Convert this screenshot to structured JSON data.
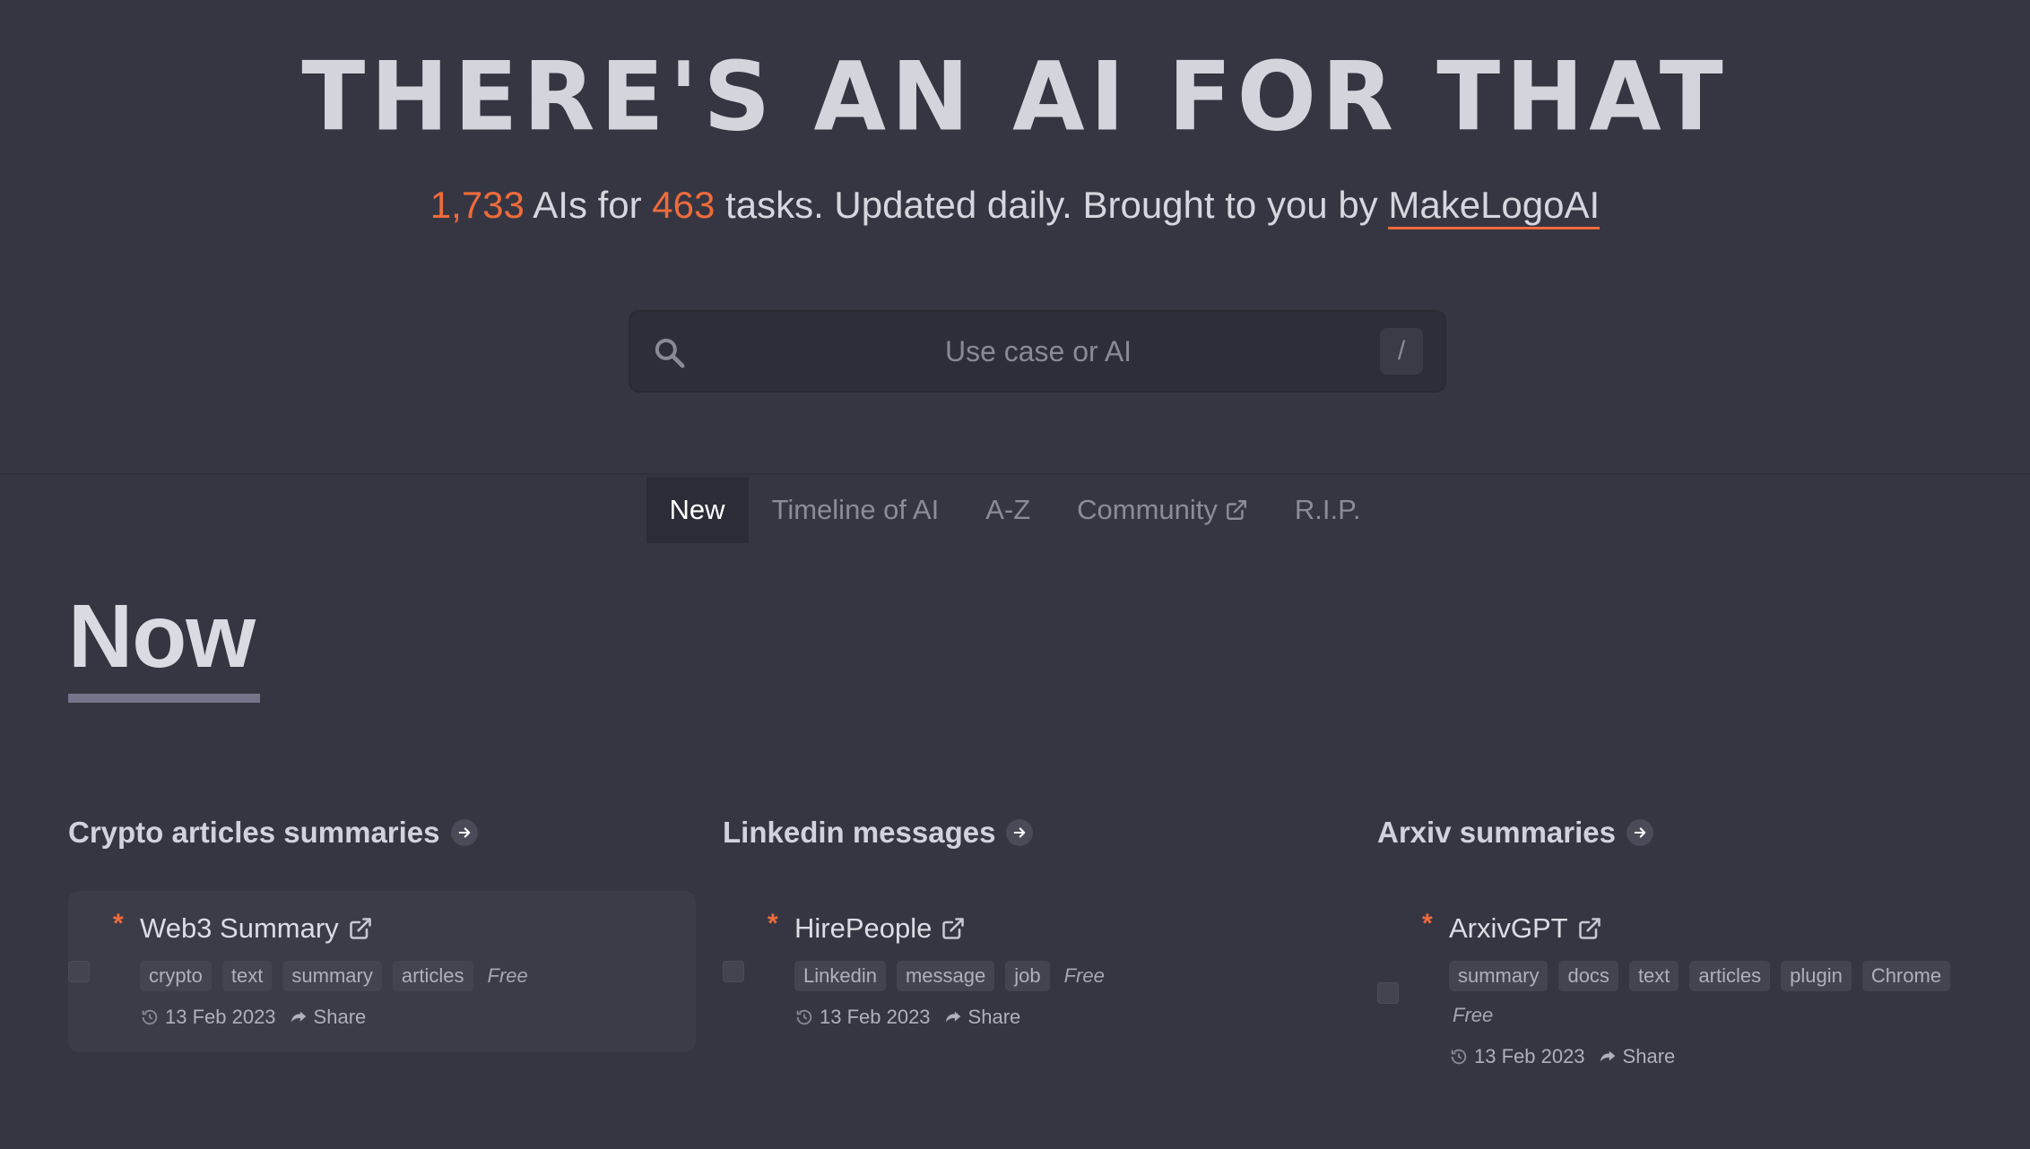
{
  "header": {
    "title": "THERE'S AN AI FOR THAT",
    "ai_count": "1,733",
    "ais_for": " AIs for ",
    "task_count": "463",
    "tasks_text": " tasks. Updated daily. Brought to you by ",
    "brand": "MakeLogoAI"
  },
  "search": {
    "placeholder": "Use case or AI",
    "shortcut": "/"
  },
  "tabs": [
    {
      "label": "New",
      "active": true
    },
    {
      "label": "Timeline of AI"
    },
    {
      "label": "A-Z"
    },
    {
      "label": "Community",
      "external": true
    },
    {
      "label": "R.I.P."
    }
  ],
  "section": {
    "title": "Now"
  },
  "columns": [
    {
      "title": "Crypto articles summaries",
      "card": {
        "name": "Web3 Summary",
        "tags": [
          "crypto",
          "text",
          "summary",
          "articles"
        ],
        "pricing": "Free",
        "date": "13 Feb 2023",
        "share": "Share"
      }
    },
    {
      "title": "Linkedin messages",
      "card": {
        "name": "HirePeople",
        "tags": [
          "Linkedin",
          "message",
          "job"
        ],
        "pricing": "Free",
        "date": "13 Feb 2023",
        "share": "Share"
      }
    },
    {
      "title": "Arxiv summaries",
      "card": {
        "name": "ArxivGPT",
        "tags": [
          "summary",
          "docs",
          "text",
          "articles",
          "plugin",
          "Chrome"
        ],
        "pricing": "Free",
        "date": "13 Feb 2023",
        "share": "Share"
      }
    }
  ],
  "colors": {
    "accent": "#ee6b3c",
    "background": "#363642"
  },
  "icons": {
    "search": "search-icon",
    "external": "external-link-icon",
    "arrow": "arrow-right-icon",
    "history": "history-icon",
    "share": "share-icon"
  }
}
